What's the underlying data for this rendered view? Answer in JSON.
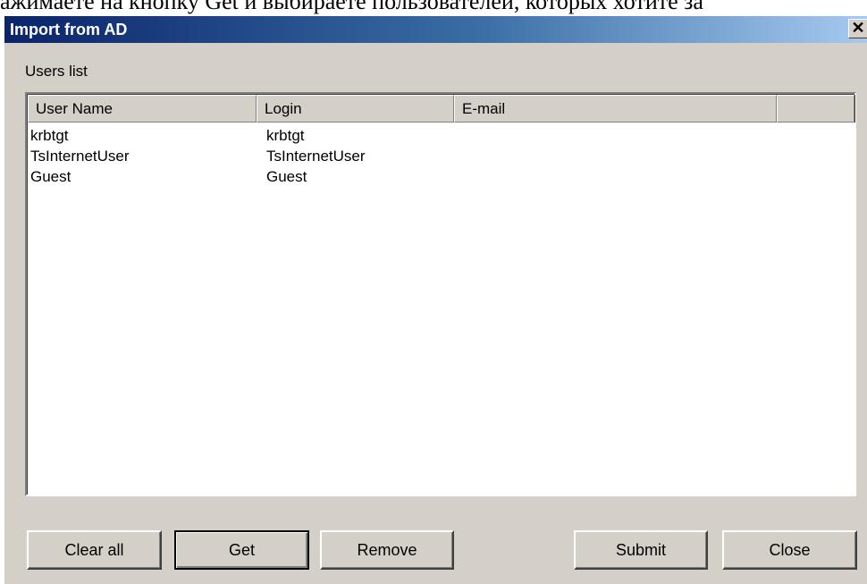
{
  "background_text": "ажимаете на кнопку Get и выбираете пользователей, которых хотите за",
  "dialog": {
    "title": "Import from AD",
    "close_glyph": "✕"
  },
  "users_list": {
    "label": "Users list",
    "columns": [
      "User Name",
      "Login",
      "E-mail",
      ""
    ],
    "rows": [
      {
        "user_name": "krbtgt",
        "login": "krbtgt",
        "email": ""
      },
      {
        "user_name": "TsInternetUser",
        "login": "TsInternetUser",
        "email": ""
      },
      {
        "user_name": "Guest",
        "login": "Guest",
        "email": ""
      }
    ]
  },
  "buttons": {
    "clear_all": "Clear all",
    "get": "Get",
    "remove": "Remove",
    "submit": "Submit",
    "close": "Close"
  },
  "colors": {
    "title_gradient_start": "#0a246a",
    "title_gradient_end": "#a6caf0",
    "dialog_face": "#d4d0c8"
  }
}
